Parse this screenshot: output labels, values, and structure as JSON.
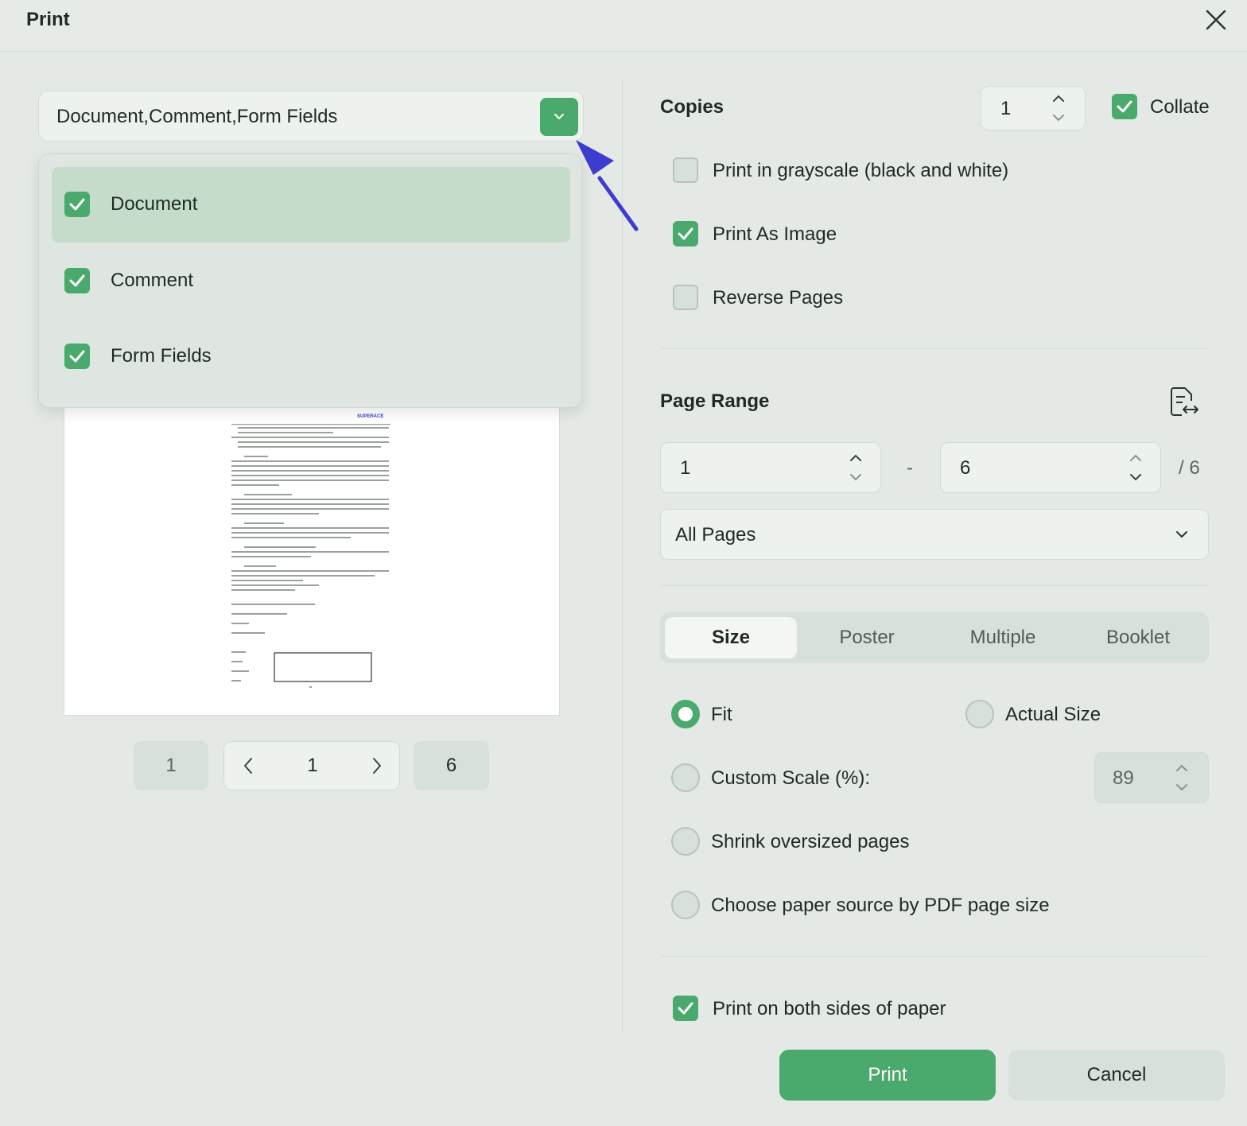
{
  "window": {
    "title": "Print"
  },
  "content_filter": {
    "value": "Document,Comment,Form Fields",
    "options": [
      {
        "label": "Document",
        "checked": true
      },
      {
        "label": "Comment",
        "checked": true
      },
      {
        "label": "Form Fields",
        "checked": true
      }
    ]
  },
  "preview": {
    "doc_header": "SUPERACE"
  },
  "pager": {
    "first": "1",
    "current": "1",
    "last": "6"
  },
  "copies": {
    "label": "Copies",
    "value": "1",
    "collate_label": "Collate",
    "collate_checked": true
  },
  "options": [
    {
      "label": "Print in grayscale (black and white)",
      "checked": false
    },
    {
      "label": "Print As Image",
      "checked": true
    },
    {
      "label": "Reverse Pages",
      "checked": false
    }
  ],
  "page_range": {
    "label": "Page Range",
    "from": "1",
    "separator": "-",
    "to": "6",
    "total": "/ 6",
    "mode": "All Pages"
  },
  "tabs": [
    "Size",
    "Poster",
    "Multiple",
    "Booklet"
  ],
  "active_tab": "Size",
  "sizing": {
    "fit": "Fit",
    "actual_size": "Actual Size",
    "custom_scale": "Custom Scale (%):",
    "custom_scale_value": "89",
    "shrink": "Shrink oversized pages",
    "paper_source": "Choose paper source by PDF page size",
    "selected": "Fit"
  },
  "duplex": {
    "label": "Print on both sides of paper",
    "checked": true
  },
  "buttons": {
    "print": "Print",
    "cancel": "Cancel"
  },
  "colors": {
    "accent": "#4aa96c",
    "background": "#e4e9e5",
    "pointer_arrow": "#3d3ccf"
  }
}
